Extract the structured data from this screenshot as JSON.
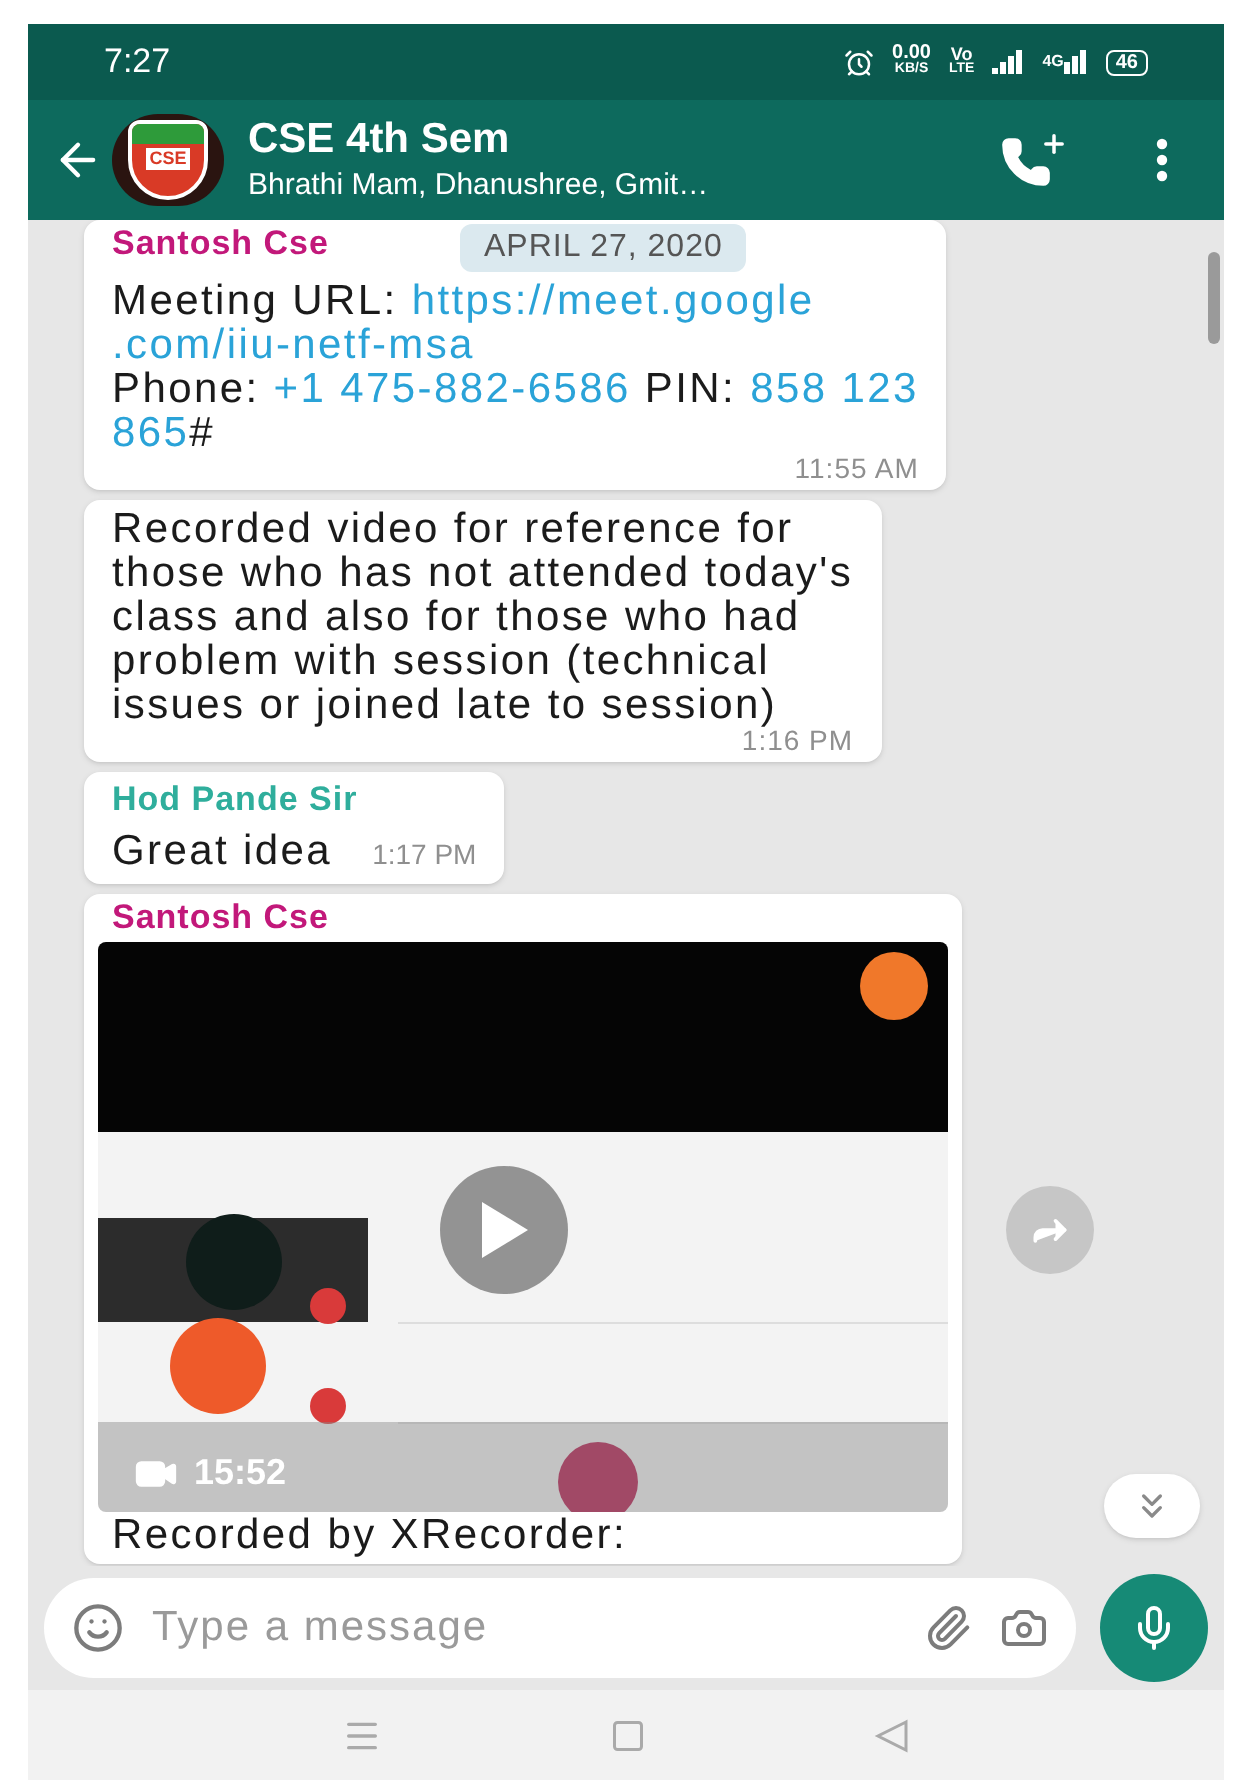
{
  "status_bar": {
    "time": "7:27",
    "speed": "0.00",
    "speed_unit": "KB/S",
    "volte_top": "Vo",
    "volte_bottom": "LTE",
    "network_type": "4G",
    "battery": "46"
  },
  "header": {
    "logo_text": "CSE",
    "title": "CSE 4th Sem",
    "subtitle": "Bhrathi Mam, Dhanushree, Gmit…"
  },
  "date_chip": "APRIL 27, 2020",
  "messages": [
    {
      "kind": "text",
      "sender": "Santosh Cse",
      "color": "#c2187a",
      "lines": [
        [
          {
            "text": "Meeting URL: ",
            "link": false
          },
          {
            "text": "https://meet.google",
            "link": true
          }
        ],
        [
          {
            "text": ".com/iiu-netf-msa",
            "link": true
          }
        ],
        [
          {
            "text": "Phone: ",
            "link": false
          },
          {
            "text": "+1 475-882-6586",
            "link": true
          },
          {
            "text": " PIN: ",
            "link": false
          },
          {
            "text": "858 123",
            "link": true
          }
        ],
        [
          {
            "text": "865",
            "link": true
          },
          {
            "text": "#",
            "link": false
          }
        ]
      ],
      "time": "11:55 AM"
    },
    {
      "kind": "text",
      "lines": [
        [
          {
            "text": "Recorded video for reference for",
            "link": false
          }
        ],
        [
          {
            "text": "those who has not attended today's",
            "link": false
          }
        ],
        [
          {
            "text": "class and also for those who had",
            "link": false
          }
        ],
        [
          {
            "text": "problem with session (technical",
            "link": false
          }
        ],
        [
          {
            "text": "issues or joined late to session)",
            "link": false
          }
        ]
      ],
      "time": "1:16 PM"
    },
    {
      "kind": "short",
      "sender": "Hod Pande Sir",
      "color": "#2fae9c",
      "text": "Great idea",
      "time": "1:17 PM"
    },
    {
      "kind": "video",
      "sender": "Santosh Cse",
      "color": "#c2187a",
      "duration": "15:52",
      "caption": "Recorded by XRecorder:"
    }
  ],
  "composer": {
    "placeholder": "Type a message"
  }
}
